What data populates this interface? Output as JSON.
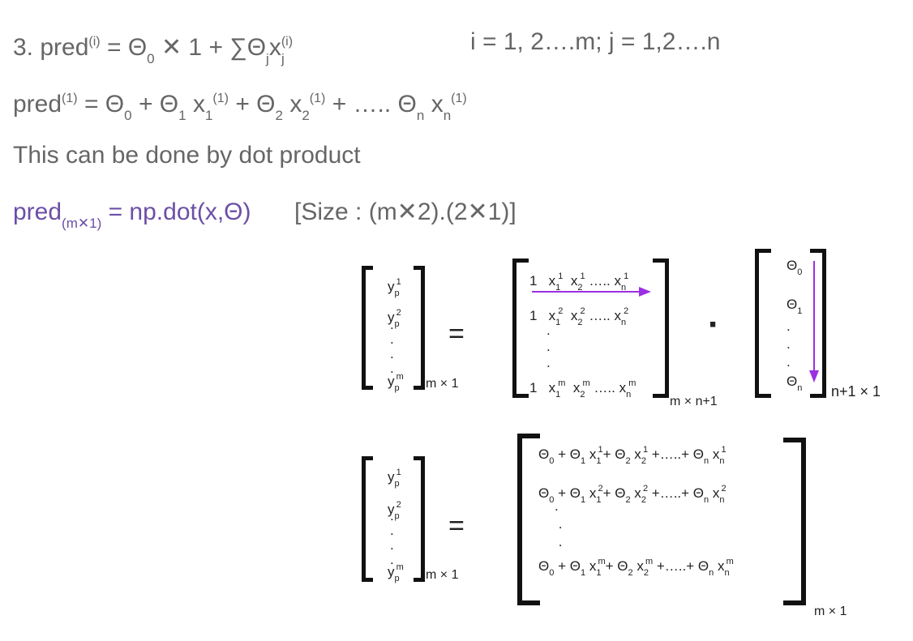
{
  "line1": {
    "prefix": "3. pred",
    "sup_i": "(i)",
    "eq": " = Θ",
    "sub_0": "0",
    "times": " ✕ 1 + ∑Θ",
    "sub_j": "j",
    "x": "x",
    "sup_i2": "(i)",
    "sub_j2": "j",
    "range": "i = 1, 2….m;  j = 1,2….n"
  },
  "line2": {
    "pred": "pred",
    "sup1": "(1)",
    "a": " = Θ",
    "s0": "0",
    "b": " + Θ",
    "s1": "1",
    "c": " x",
    "s1b": "1",
    "sup2": "(1)",
    "d": " + Θ",
    "s2": "2",
    "e": " x",
    "s2b": "2",
    "sup3": "(1)",
    "f": " + …..  Θ",
    "sn": "n",
    "g": " x",
    "snb": "n",
    "sup4": "(1)"
  },
  "line3": {
    "text": "This can be done by dot product"
  },
  "line4": {
    "pred": "pred",
    "sub": "(m✕1)",
    "rest": " = np.dot(x,Θ)",
    "size": "[Size :   (m✕2).(2✕1)]"
  },
  "matrix1": {
    "y_rows": [
      {
        "y": "y",
        "p": "p",
        "sup": "1"
      },
      {
        "y": "y",
        "p": "p",
        "sup": "2"
      },
      {
        "y": "y",
        "p": "p",
        "sup": "m"
      }
    ],
    "dim_y": "m × 1",
    "equals": "=",
    "x_rows": [
      {
        "one": "1",
        "x1": "x",
        "s1": "1",
        "u1": "1",
        "x2": "x",
        "s2": "2",
        "u2": "1",
        "dots": "…..",
        "xn": "x",
        "sn": "n",
        "un": "1"
      },
      {
        "one": "1",
        "x1": "x",
        "s1": "1",
        "u1": "2",
        "x2": "x",
        "s2": "2",
        "u2": "2",
        "dots": "…..",
        "xn": "x",
        "sn": "n",
        "un": "2"
      },
      {
        "one": "1",
        "x1": "x",
        "s1": "1",
        "u1": "m",
        "x2": "x",
        "s2": "2",
        "u2": "m",
        "dots": "…..",
        "xn": "x",
        "sn": "n",
        "un": "m"
      }
    ],
    "dim_x": "m × n+1",
    "dot_op": "·",
    "theta_rows": [
      {
        "t": "Θ",
        "s": "0"
      },
      {
        "t": "Θ",
        "s": "1"
      },
      {
        "t": "Θ",
        "s": "n"
      }
    ],
    "dim_theta": "n+1  × 1",
    "arrow_color": "#9b30e0"
  },
  "matrix2": {
    "y_rows": [
      {
        "y": "y",
        "p": "p",
        "sup": "1"
      },
      {
        "y": "y",
        "p": "p",
        "sup": "2"
      },
      {
        "y": "y",
        "p": "p",
        "sup": "m"
      }
    ],
    "dim_y": "m × 1",
    "equals": "=",
    "rows": [
      {
        "sup": "1"
      },
      {
        "sup": "2"
      },
      {
        "sup": "m"
      }
    ],
    "dim_result": "m × 1"
  },
  "colors": {
    "text": "#666666",
    "accent": "#6c4fa6",
    "matrix": "#222222"
  }
}
